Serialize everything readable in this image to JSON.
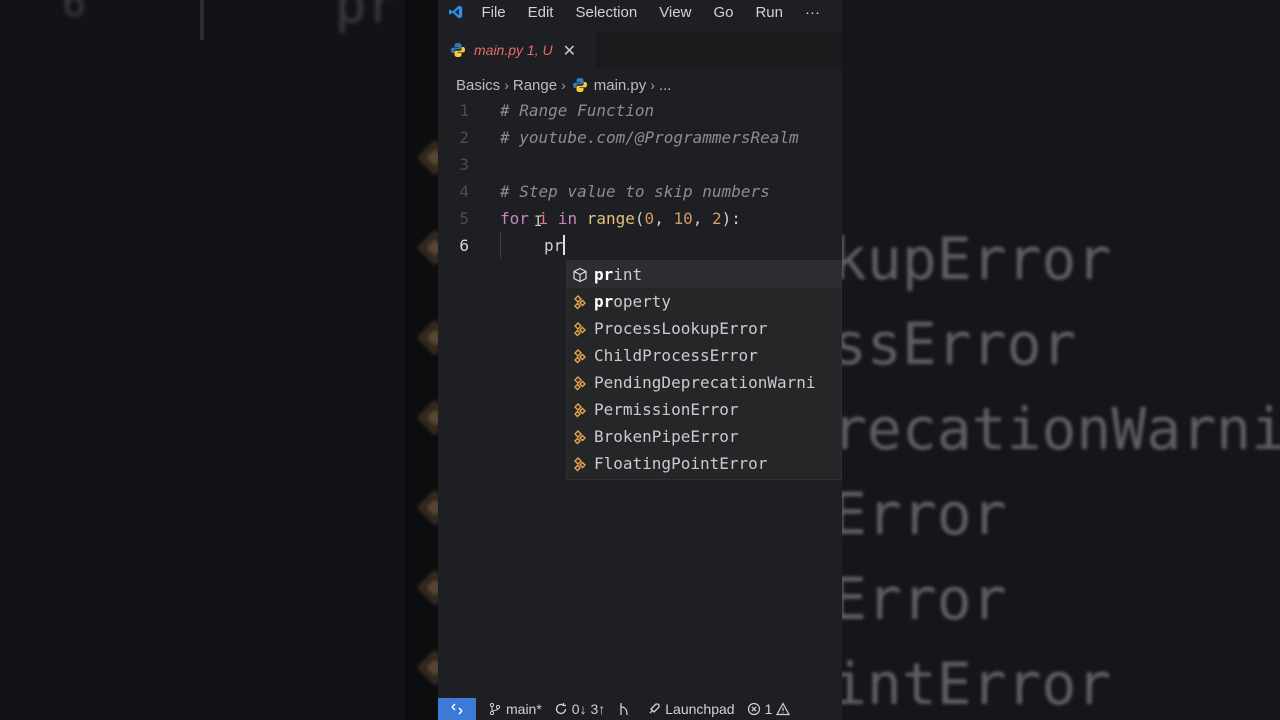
{
  "menubar": {
    "items": [
      "File",
      "Edit",
      "Selection",
      "View",
      "Go",
      "Run"
    ],
    "more": "···"
  },
  "tab": {
    "label": "main.py 1, U",
    "close": "✕"
  },
  "breadcrumbs": {
    "items": [
      "Basics",
      "Range",
      "main.py",
      "..."
    ]
  },
  "code": {
    "lines": [
      {
        "num": "1",
        "comment": "# Range Function"
      },
      {
        "num": "2",
        "comment": "# youtube.com/@ProgrammersRealm"
      },
      {
        "num": "3"
      },
      {
        "num": "4",
        "comment": "# Step value to skip numbers"
      },
      {
        "num": "5",
        "kw_for": "for",
        "var": "i",
        "kw_in": "in",
        "fn": "range",
        "open": "(",
        "a": "0",
        "sep1": ", ",
        "b": "10",
        "sep2": ", ",
        "c": "2",
        "close": "):"
      },
      {
        "num": "6",
        "typed": "pr"
      }
    ]
  },
  "suggestions": [
    {
      "icon": "cube-icon",
      "match": "pr",
      "rest": "int"
    },
    {
      "icon": "class-icon",
      "match": "pr",
      "rest": "operty"
    },
    {
      "icon": "class-icon",
      "pre": "",
      "label": "ProcessLookupError"
    },
    {
      "icon": "class-icon",
      "label": "ChildProcessError"
    },
    {
      "icon": "class-icon",
      "label": "PendingDeprecationWarni"
    },
    {
      "icon": "class-icon",
      "label": "PermissionError"
    },
    {
      "icon": "class-icon",
      "label": "BrokenPipeError"
    },
    {
      "icon": "class-icon",
      "label": "FloatingPointError"
    }
  ],
  "background_ghost": {
    "left_number": "6",
    "left_text": "pr",
    "right_lines": [
      "kupError",
      "ssError",
      "recationWarni",
      "Error",
      "Error",
      "intError"
    ]
  },
  "statusbar": {
    "branch": "main*",
    "sync": "0↓ 3↑",
    "launchpad": "Launchpad",
    "errors": "1"
  },
  "colors": {
    "accent": "#3d7ad8",
    "error_tab": "#e86a6a",
    "keyword": "#c586c0",
    "function": "#e5c07b",
    "number": "#d19a66",
    "class_icon": "#e8a54a"
  }
}
